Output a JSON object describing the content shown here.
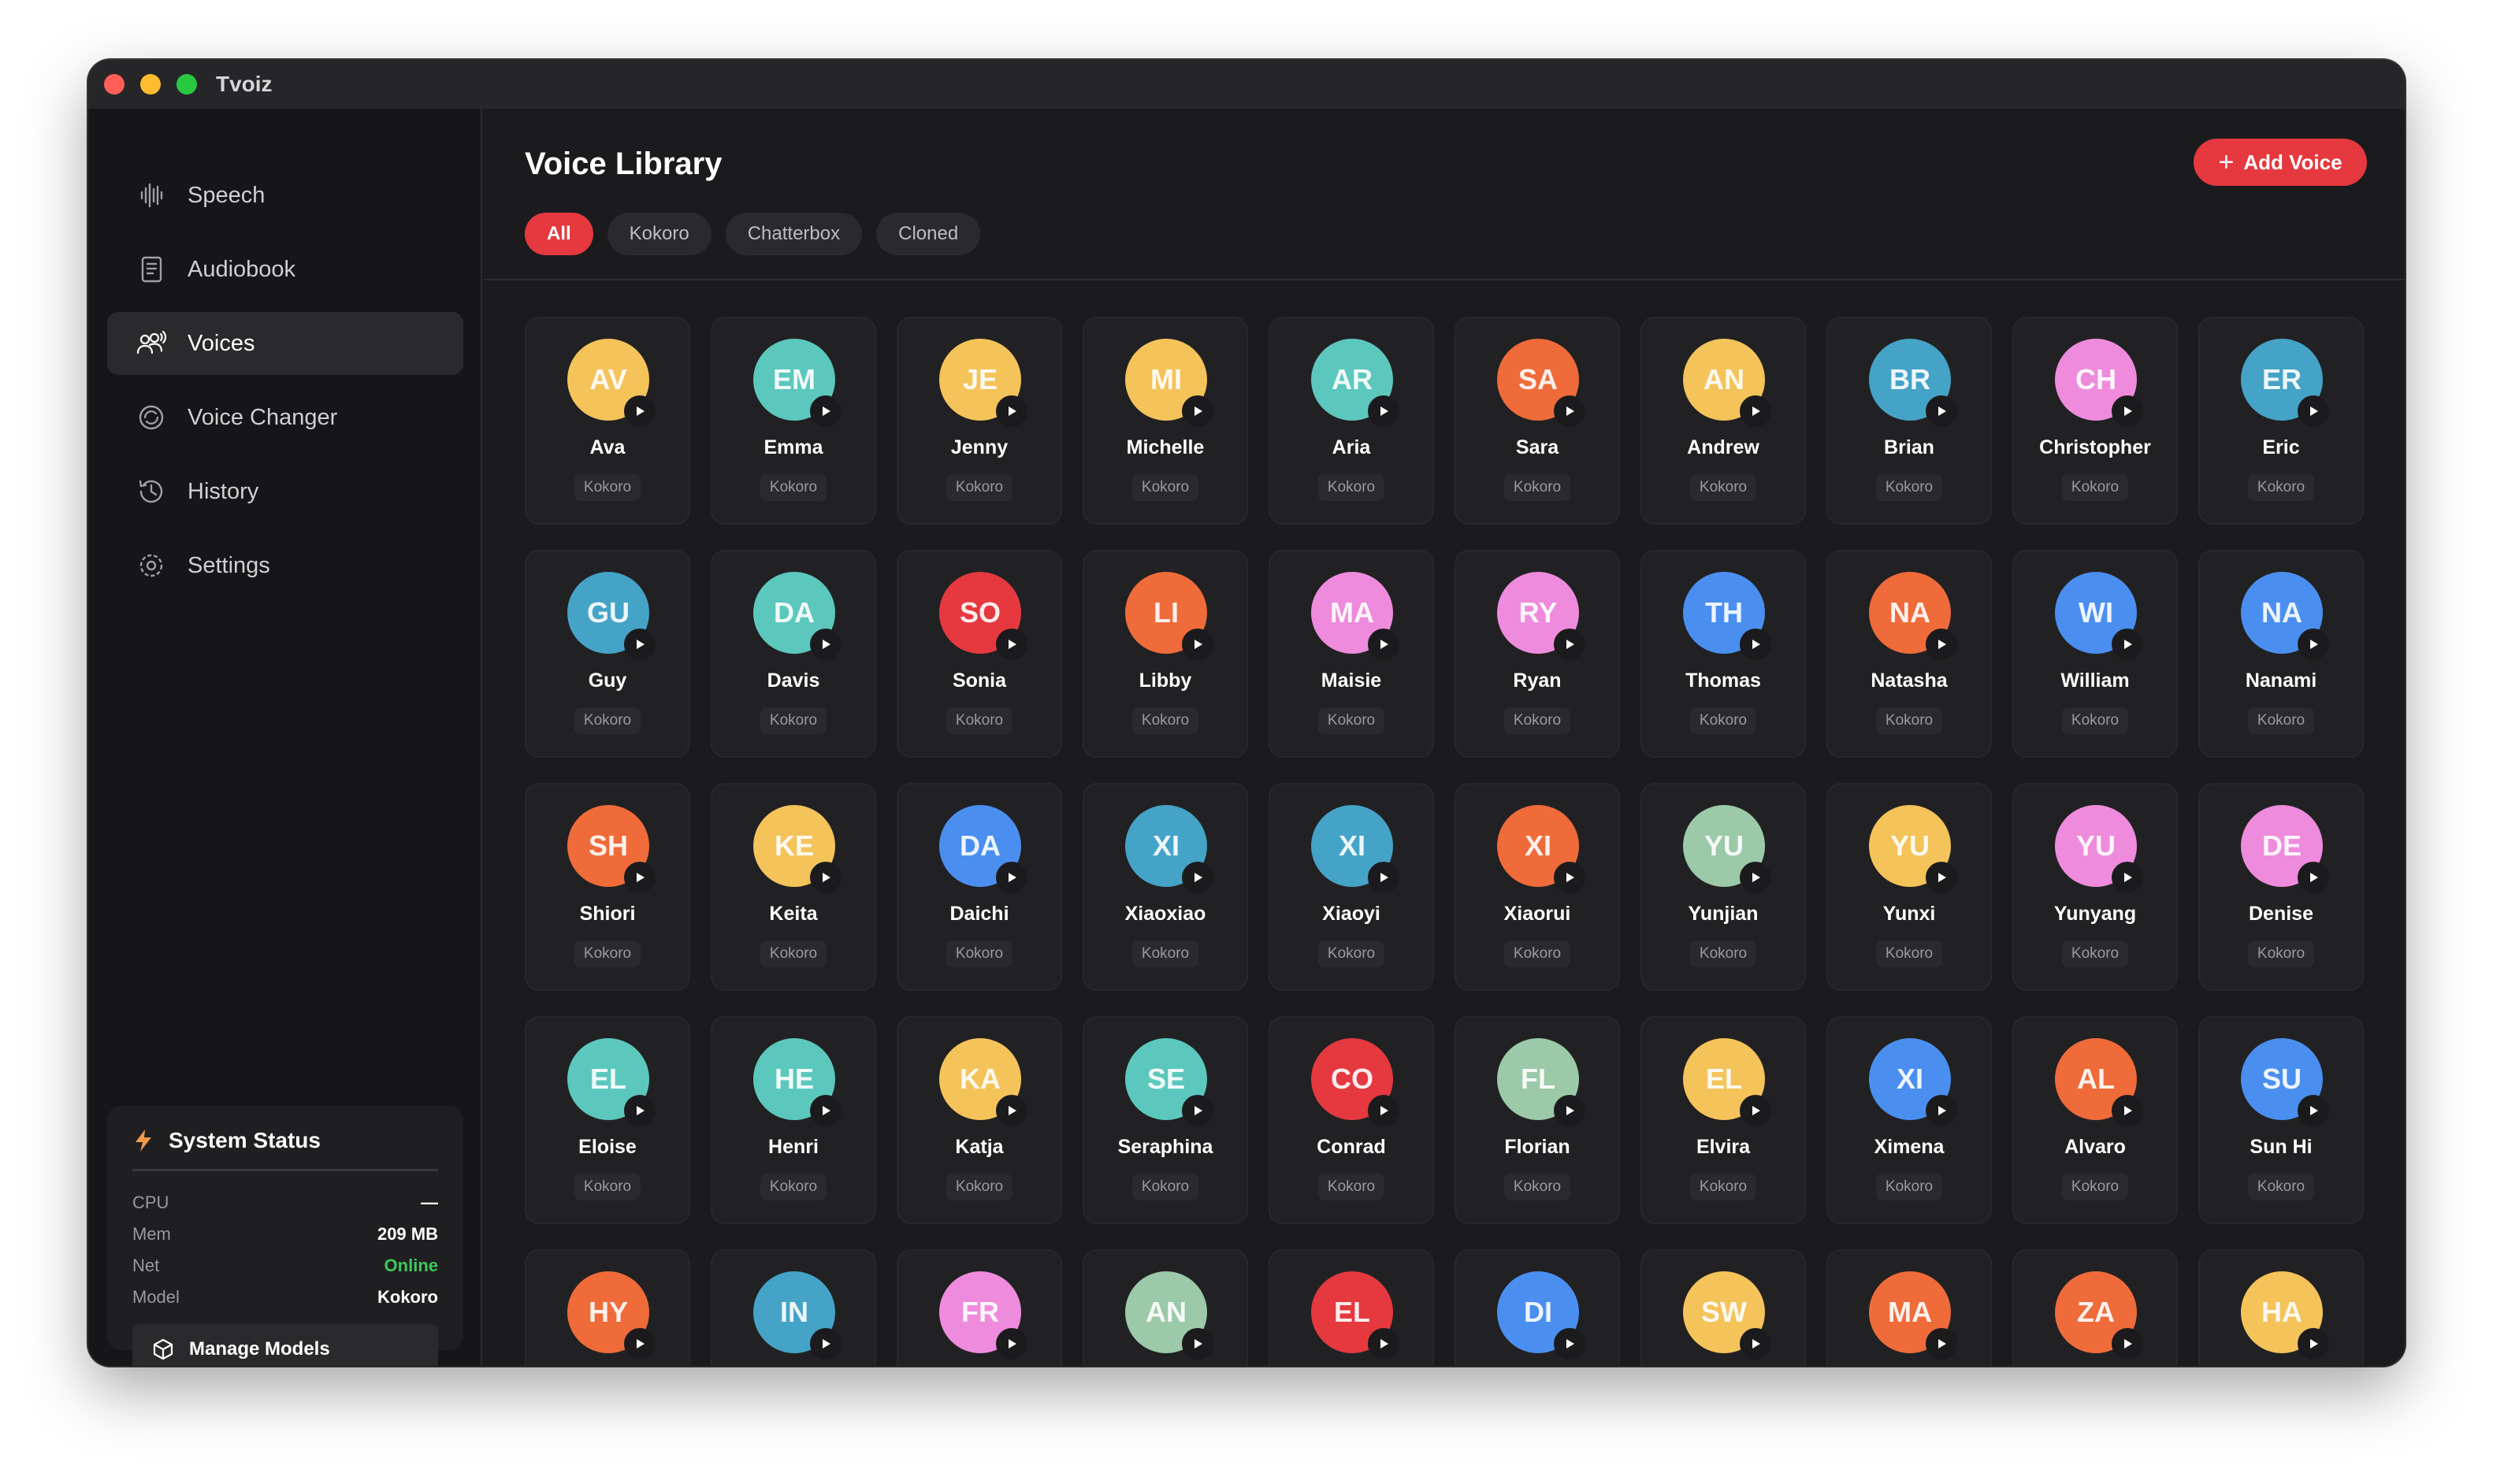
{
  "app": {
    "title": "Tvoiz"
  },
  "sidebar": {
    "items": [
      {
        "label": "Speech",
        "icon": "waveform-icon"
      },
      {
        "label": "Audiobook",
        "icon": "book-icon"
      },
      {
        "label": "Voices",
        "icon": "users-voice-icon",
        "active": true
      },
      {
        "label": "Voice Changer",
        "icon": "voice-changer-icon"
      },
      {
        "label": "History",
        "icon": "history-icon"
      },
      {
        "label": "Settings",
        "icon": "gear-icon"
      }
    ],
    "status": {
      "title": "System Status",
      "rows": [
        {
          "key": "CPU",
          "value": "—"
        },
        {
          "key": "Mem",
          "value": "209 MB"
        },
        {
          "key": "Net",
          "value": "Online"
        },
        {
          "key": "Model",
          "value": "Kokoro"
        }
      ],
      "manage_label": "Manage Models"
    }
  },
  "main": {
    "title": "Voice Library",
    "add_label": "Add Voice",
    "filters": [
      {
        "label": "All",
        "active": true
      },
      {
        "label": "Kokoro"
      },
      {
        "label": "Chatterbox"
      },
      {
        "label": "Cloned"
      }
    ]
  },
  "voices": [
    {
      "initials": "AV",
      "name": "Ava",
      "model": "Kokoro",
      "color": "#f4c35a"
    },
    {
      "initials": "EM",
      "name": "Emma",
      "model": "Kokoro",
      "color": "#5cc8bd"
    },
    {
      "initials": "JE",
      "name": "Jenny",
      "model": "Kokoro",
      "color": "#f4c35a"
    },
    {
      "initials": "MI",
      "name": "Michelle",
      "model": "Kokoro",
      "color": "#f4c35a"
    },
    {
      "initials": "AR",
      "name": "Aria",
      "model": "Kokoro",
      "color": "#5cc8bd"
    },
    {
      "initials": "SA",
      "name": "Sara",
      "model": "Kokoro",
      "color": "#ef6b3a"
    },
    {
      "initials": "AN",
      "name": "Andrew",
      "model": "Kokoro",
      "color": "#f4c35a"
    },
    {
      "initials": "BR",
      "name": "Brian",
      "model": "Kokoro",
      "color": "#45a3c7"
    },
    {
      "initials": "CH",
      "name": "Christopher",
      "model": "Kokoro",
      "color": "#ee8bdc"
    },
    {
      "initials": "ER",
      "name": "Eric",
      "model": "Kokoro",
      "color": "#45a3c7"
    },
    {
      "initials": "GU",
      "name": "Guy",
      "model": "Kokoro",
      "color": "#45a3c7"
    },
    {
      "initials": "DA",
      "name": "Davis",
      "model": "Kokoro",
      "color": "#5cc8bd"
    },
    {
      "initials": "SO",
      "name": "Sonia",
      "model": "Kokoro",
      "color": "#e5393f"
    },
    {
      "initials": "LI",
      "name": "Libby",
      "model": "Kokoro",
      "color": "#ef6b3a"
    },
    {
      "initials": "MA",
      "name": "Maisie",
      "model": "Kokoro",
      "color": "#ee8bdc"
    },
    {
      "initials": "RY",
      "name": "Ryan",
      "model": "Kokoro",
      "color": "#ee8bdc"
    },
    {
      "initials": "TH",
      "name": "Thomas",
      "model": "Kokoro",
      "color": "#4a8ff0"
    },
    {
      "initials": "NA",
      "name": "Natasha",
      "model": "Kokoro",
      "color": "#ef6b3a"
    },
    {
      "initials": "WI",
      "name": "William",
      "model": "Kokoro",
      "color": "#4a8ff0"
    },
    {
      "initials": "NA",
      "name": "Nanami",
      "model": "Kokoro",
      "color": "#4a8ff0"
    },
    {
      "initials": "SH",
      "name": "Shiori",
      "model": "Kokoro",
      "color": "#ef6b3a"
    },
    {
      "initials": "KE",
      "name": "Keita",
      "model": "Kokoro",
      "color": "#f4c35a"
    },
    {
      "initials": "DA",
      "name": "Daichi",
      "model": "Kokoro",
      "color": "#4a8ff0"
    },
    {
      "initials": "XI",
      "name": "Xiaoxiao",
      "model": "Kokoro",
      "color": "#45a3c7"
    },
    {
      "initials": "XI",
      "name": "Xiaoyi",
      "model": "Kokoro",
      "color": "#45a3c7"
    },
    {
      "initials": "XI",
      "name": "Xiaorui",
      "model": "Kokoro",
      "color": "#ef6b3a"
    },
    {
      "initials": "YU",
      "name": "Yunjian",
      "model": "Kokoro",
      "color": "#9cc9a8"
    },
    {
      "initials": "YU",
      "name": "Yunxi",
      "model": "Kokoro",
      "color": "#f4c35a"
    },
    {
      "initials": "YU",
      "name": "Yunyang",
      "model": "Kokoro",
      "color": "#ee8bdc"
    },
    {
      "initials": "DE",
      "name": "Denise",
      "model": "Kokoro",
      "color": "#ee8bdc"
    },
    {
      "initials": "EL",
      "name": "Eloise",
      "model": "Kokoro",
      "color": "#5cc8bd"
    },
    {
      "initials": "HE",
      "name": "Henri",
      "model": "Kokoro",
      "color": "#5cc8bd"
    },
    {
      "initials": "KA",
      "name": "Katja",
      "model": "Kokoro",
      "color": "#f4c35a"
    },
    {
      "initials": "SE",
      "name": "Seraphina",
      "model": "Kokoro",
      "color": "#5cc8bd"
    },
    {
      "initials": "CO",
      "name": "Conrad",
      "model": "Kokoro",
      "color": "#e5393f"
    },
    {
      "initials": "FL",
      "name": "Florian",
      "model": "Kokoro",
      "color": "#9cc9a8"
    },
    {
      "initials": "EL",
      "name": "Elvira",
      "model": "Kokoro",
      "color": "#f4c35a"
    },
    {
      "initials": "XI",
      "name": "Ximena",
      "model": "Kokoro",
      "color": "#4a8ff0"
    },
    {
      "initials": "AL",
      "name": "Alvaro",
      "model": "Kokoro",
      "color": "#ef6b3a"
    },
    {
      "initials": "SU",
      "name": "Sun Hi",
      "model": "Kokoro",
      "color": "#4a8ff0"
    },
    {
      "initials": "HY",
      "name": "",
      "model": "",
      "color": "#ef6b3a"
    },
    {
      "initials": "IN",
      "name": "",
      "model": "",
      "color": "#45a3c7"
    },
    {
      "initials": "FR",
      "name": "",
      "model": "",
      "color": "#ee8bdc"
    },
    {
      "initials": "AN",
      "name": "",
      "model": "",
      "color": "#9cc9a8"
    },
    {
      "initials": "EL",
      "name": "",
      "model": "",
      "color": "#e5393f"
    },
    {
      "initials": "DI",
      "name": "",
      "model": "",
      "color": "#4a8ff0"
    },
    {
      "initials": "SW",
      "name": "",
      "model": "",
      "color": "#f4c35a"
    },
    {
      "initials": "MA",
      "name": "",
      "model": "",
      "color": "#ef6b3a"
    },
    {
      "initials": "ZA",
      "name": "",
      "model": "",
      "color": "#ef6b3a"
    },
    {
      "initials": "HA",
      "name": "",
      "model": "",
      "color": "#f4c35a"
    }
  ]
}
